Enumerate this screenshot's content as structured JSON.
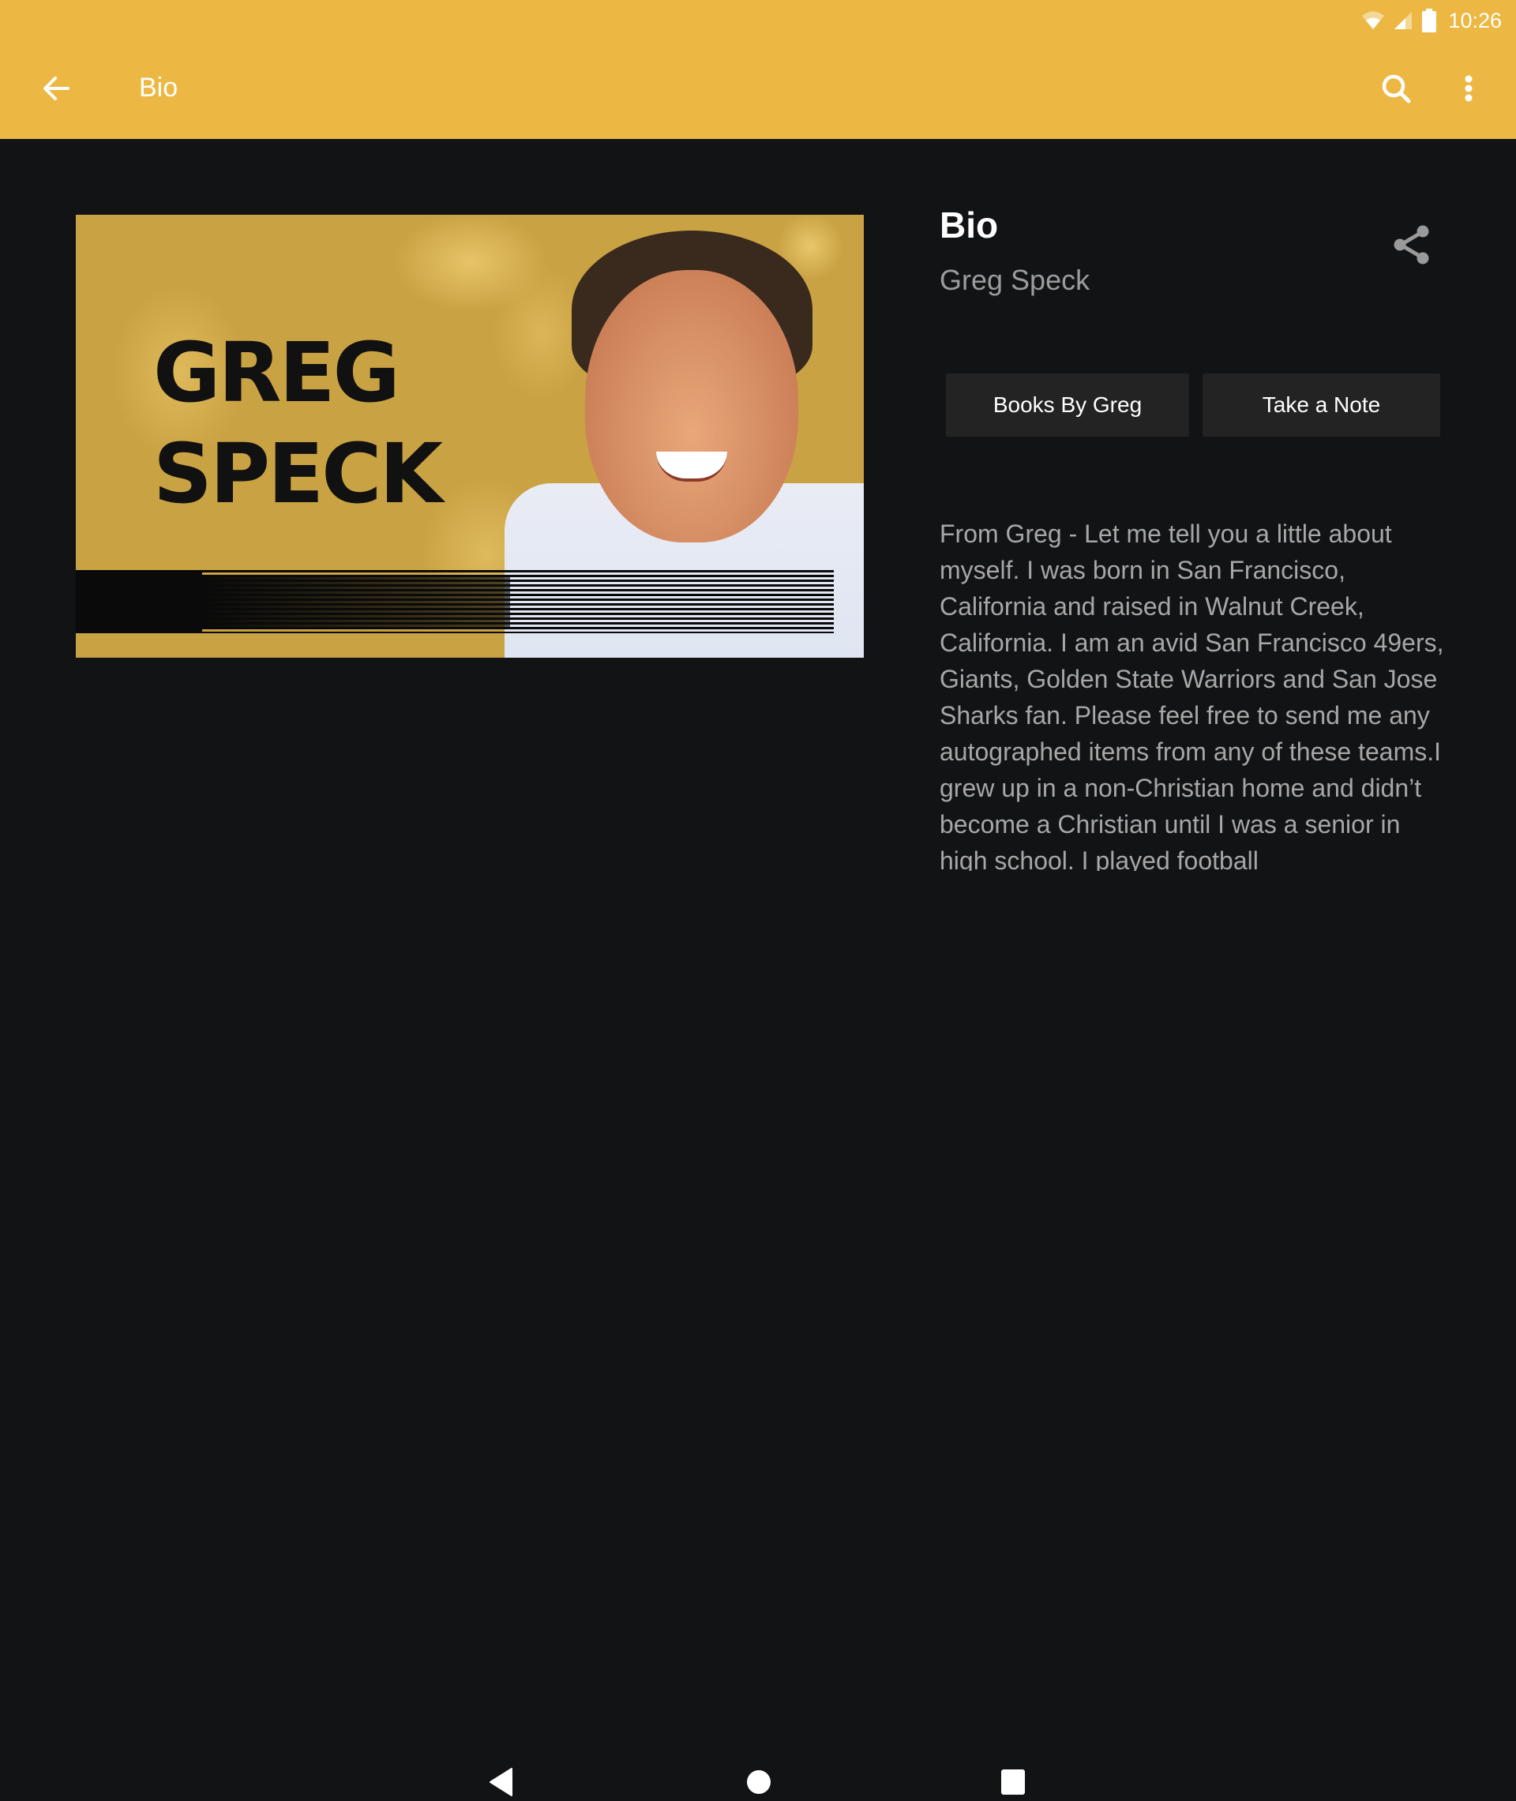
{
  "status_bar": {
    "time": "10:26",
    "icons": [
      "wifi-icon",
      "cellular-signal-icon",
      "battery-icon"
    ]
  },
  "toolbar": {
    "title": "Bio",
    "back_icon": "arrow-back-icon",
    "actions": [
      "search-icon",
      "more-vert-icon"
    ],
    "background_color": "#ECB843"
  },
  "hero_image": {
    "text_line1": "GREG",
    "text_line2": "SPECK",
    "alt": "Greg Speck promotional image"
  },
  "content": {
    "heading": "Bio",
    "author": "Greg Speck",
    "share_icon": "share-icon",
    "buttons": [
      {
        "label": "Books By Greg"
      },
      {
        "label": "Take a Note"
      }
    ],
    "bio_text": "From Greg - Let me tell you a little about myself. I was born in San Francisco, California and raised in Walnut Creek, California. I am an avid San Francisco 49ers, Giants, Golden State Warriors and San Jose Sharks fan. Please feel free to send me any autographed items from any of these teams.I grew up in a non-Christian home and didn’t become a Christian until I was a senior in high school. I played football"
  },
  "nav_bar": {
    "buttons": [
      "back-triangle-icon",
      "home-circle-icon",
      "recents-square-icon"
    ]
  }
}
